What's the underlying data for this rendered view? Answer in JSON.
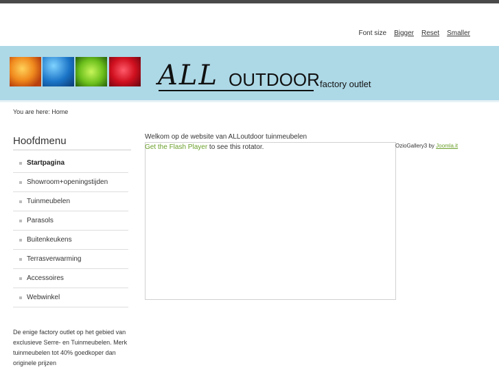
{
  "font_controls": {
    "label": "Font size",
    "bigger": "Bigger",
    "reset": "Reset",
    "smaller": "Smaller"
  },
  "header": {
    "logo_all": "ALL",
    "logo_outdoor": "OUTDOOR",
    "tagline": "factory outlet",
    "background_color": "#add8e6",
    "tiles": [
      "fire-image",
      "water-image",
      "leaf-image",
      "rose-image"
    ]
  },
  "breadcrumb": "You are here: Home",
  "sidebar": {
    "title": "Hoofdmenu",
    "items": [
      {
        "label": "Startpagina",
        "active": true
      },
      {
        "label": "Showroom+openingstijden"
      },
      {
        "label": "Tuinmeubelen"
      },
      {
        "label": "Parasols"
      },
      {
        "label": "Buitenkeukens"
      },
      {
        "label": "Terrasverwarming"
      },
      {
        "label": "Accessoires"
      },
      {
        "label": "Webwinkel"
      }
    ],
    "description": "De enige factory outlet op het gebied van exclusieve Serre- en Tuinmeubelen. Merk tuinmeubelen tot 40% goedkoper dan originele prijzen"
  },
  "main": {
    "welcome": "Welkom op de website van ALLoutdoor tuinmeubelen",
    "flash_link": "Get the Flash Player",
    "flash_text": " to see this rotator.",
    "credit_text": "OzioGallery3 by ",
    "credit_link": "Joomla.it"
  }
}
